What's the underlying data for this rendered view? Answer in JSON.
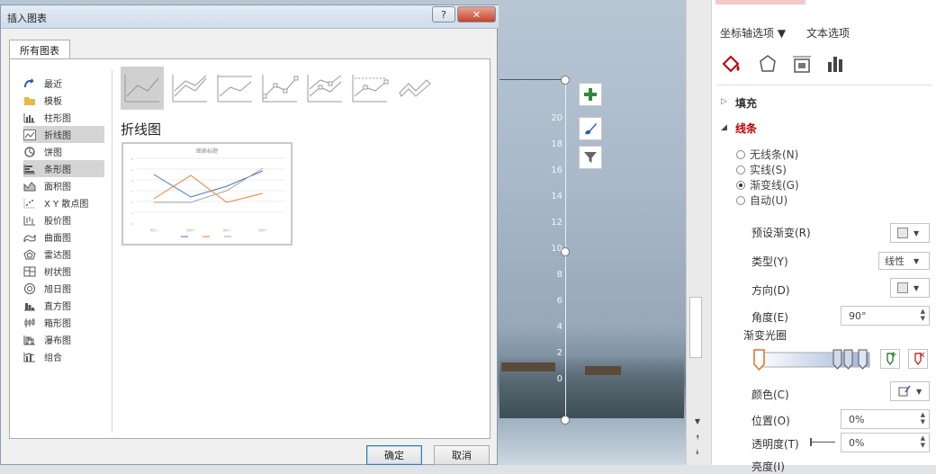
{
  "dialog": {
    "title": "插入图表",
    "help_label": "?",
    "close_label": "✕",
    "tab_label": "所有图表",
    "categories": [
      {
        "label": "最近",
        "icon": "recent-icon"
      },
      {
        "label": "模板",
        "icon": "template-icon"
      },
      {
        "label": "柱形图",
        "icon": "column-chart-icon"
      },
      {
        "label": "折线图",
        "icon": "line-chart-icon"
      },
      {
        "label": "饼图",
        "icon": "pie-chart-icon"
      },
      {
        "label": "条形图",
        "icon": "bar-chart-icon"
      },
      {
        "label": "面积图",
        "icon": "area-chart-icon"
      },
      {
        "label": "X Y 散点图",
        "icon": "scatter-chart-icon"
      },
      {
        "label": "股价图",
        "icon": "stock-chart-icon"
      },
      {
        "label": "曲面图",
        "icon": "surface-chart-icon"
      },
      {
        "label": "雷达图",
        "icon": "radar-chart-icon"
      },
      {
        "label": "树状图",
        "icon": "treemap-chart-icon"
      },
      {
        "label": "旭日图",
        "icon": "sunburst-chart-icon"
      },
      {
        "label": "直方图",
        "icon": "histogram-chart-icon"
      },
      {
        "label": "箱形图",
        "icon": "box-whisker-chart-icon"
      },
      {
        "label": "瀑布图",
        "icon": "waterfall-chart-icon"
      },
      {
        "label": "组合",
        "icon": "combo-chart-icon"
      }
    ],
    "selected_category": "折线图",
    "type_title": "折线图",
    "preview_title": "图表标题",
    "ok_label": "确定",
    "cancel_label": "取消"
  },
  "slide": {
    "y_ticks": [
      "20",
      "18",
      "16",
      "14",
      "12",
      "10",
      "8",
      "6",
      "4",
      "2",
      "0"
    ]
  },
  "format_pane": {
    "tabs": {
      "axis_options": "坐标轴选项 ▼",
      "text_options": "文本选项"
    },
    "sections": {
      "fill": "填充",
      "line": "线条"
    },
    "line_options": [
      {
        "label": "无线条(N)",
        "checked": false
      },
      {
        "label": "实线(S)",
        "checked": false
      },
      {
        "label": "渐变线(G)",
        "checked": true
      },
      {
        "label": "自动(U)",
        "checked": false
      }
    ],
    "fields": {
      "preset_gradient": "预设渐变(R)",
      "type": "类型(Y)",
      "type_value": "线性",
      "direction": "方向(D)",
      "angle": "角度(E)",
      "angle_value": "90°",
      "gradient_stops": "渐变光圈",
      "color": "颜色(C)",
      "position": "位置(O)",
      "position_value": "0%",
      "transparency": "透明度(T)",
      "transparency_value": "0%",
      "brightness": "亮度(I)"
    }
  },
  "colors": {
    "series1": "#4472c4",
    "series2": "#ed7d31",
    "series3": "#a5a5a5",
    "accent_red": "#c00000",
    "plus_green": "#2e8b3d"
  }
}
